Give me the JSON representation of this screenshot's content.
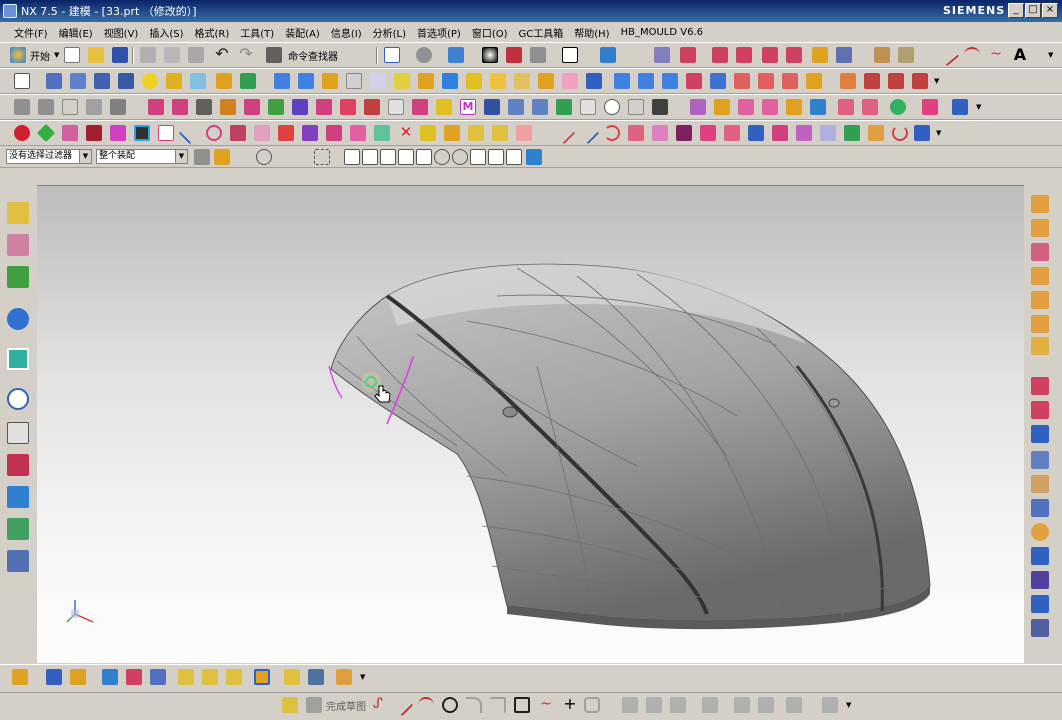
{
  "window": {
    "title": "NX 7.5 - 建模 - [33.prt （修改的）]",
    "brand": "SIEMENS",
    "controls": [
      "_",
      "□",
      "×"
    ]
  },
  "menu": [
    "文件(F)",
    "编辑(E)",
    "视图(V)",
    "插入(S)",
    "格式(R)",
    "工具(T)",
    "装配(A)",
    "信息(I)",
    "分析(L)",
    "首选项(P)",
    "窗口(O)",
    "GC工具箱",
    "帮助(H)",
    "HB_MOULD V6.6"
  ],
  "toolbar": {
    "start_label": "开始",
    "command_finder_label": "命令查找器"
  },
  "selection": {
    "filter_value": "没有选择过滤器",
    "scope_value": "整个装配"
  },
  "sketch_toolbar": {
    "finish_label": "完成草图"
  },
  "colors": {
    "titlebar": "#0a246a",
    "accent_magenta": "#e040e0",
    "accent_cyan": "#20c0c0",
    "model_gray": "#9a9a9a"
  },
  "icons": {
    "viewport_cursor": "hand-cursor-icon",
    "triad": "wcs-triad-icon"
  }
}
